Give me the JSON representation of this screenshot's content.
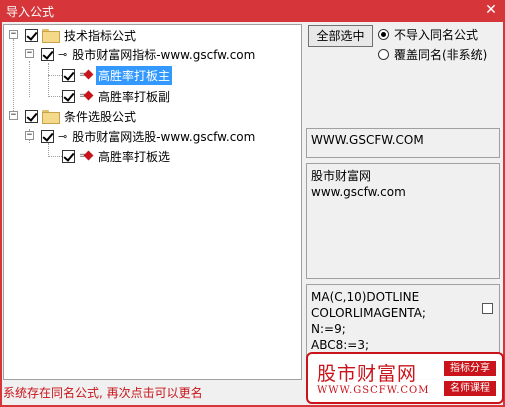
{
  "window": {
    "title": "导入公式",
    "close_glyph": "✕"
  },
  "tree": {
    "group1": {
      "label": "技术指标公式",
      "expander": "−"
    },
    "group1_child": {
      "label": "股市财富网指标-www.gscfw.com",
      "expander": "−"
    },
    "group1_leaf": {
      "label": "高胜率打板主"
    },
    "group1_leaf2": {
      "label": "高胜率打板副"
    },
    "group2": {
      "label": "条件选股公式",
      "expander": "−"
    },
    "group2_child": {
      "label": "股市财富网选股-www.gscfw.com",
      "expander": "−"
    },
    "group2_leaf": {
      "label": "高胜率打板选"
    }
  },
  "controls": {
    "select_all": "全部选中",
    "option_skip": "不导入同名公式",
    "option_overwrite": "覆盖同名(非系统)"
  },
  "info": {
    "url": "WWW.GSCFW.COM",
    "desc_line1": "股市财富网",
    "desc_line2": "www.gscfw.com",
    "code_lines": [
      "MA(C,10)DOTLINE",
      "COLORLIMAGENTA;",
      "N:=9;",
      "ABC8:=3;"
    ]
  },
  "status": "系统存在同名公式, 再次点击可以更名",
  "watermark": {
    "brand": "股市财富网",
    "url": "WWW.GSCFW.COM",
    "tag1": "指标分享",
    "tag2": "名师课程"
  },
  "colors": {
    "accent": "#d6363a",
    "selection": "#3399ff",
    "status": "#c8141a"
  }
}
